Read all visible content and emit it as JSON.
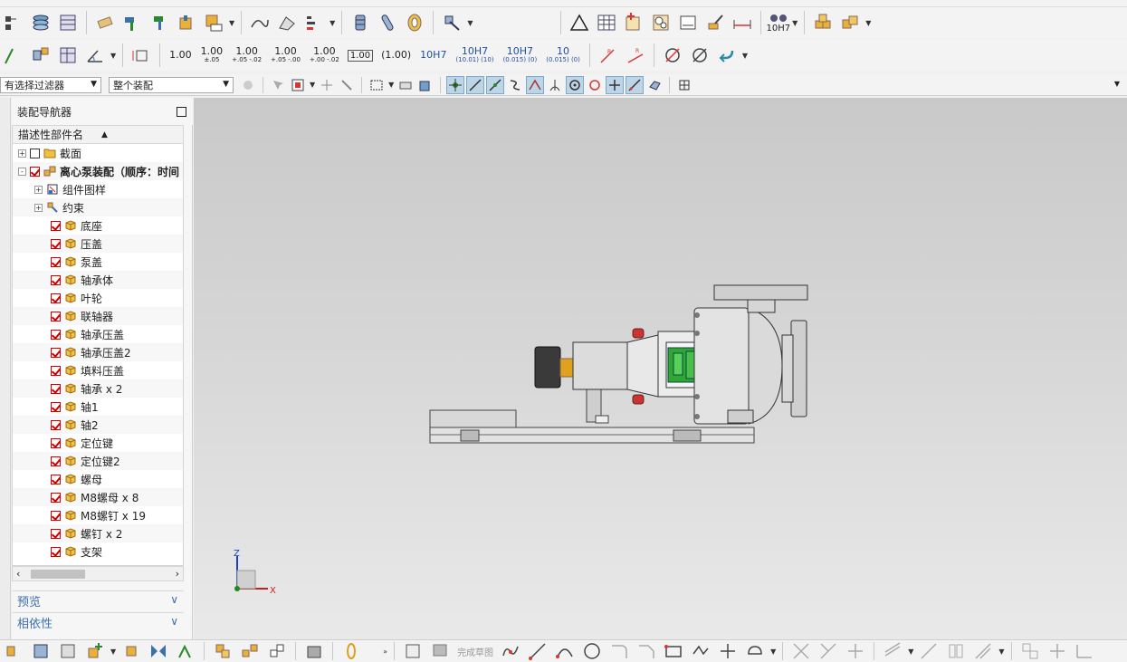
{
  "toolbar_row2": {
    "tolerances": [
      {
        "main": "1.00",
        "sub": ""
      },
      {
        "main": "1.00",
        "sub": "±.05"
      },
      {
        "main": "1.00",
        "sub": "+.05 -.02"
      },
      {
        "main": "1.00",
        "sub": "+.05 -.00"
      },
      {
        "main": "1.00",
        "sub": "+.00 -.02"
      }
    ],
    "boxed_value": "1.00",
    "paren_value": "(1.00)",
    "fit1": "10H7",
    "fit2_main": "10H7",
    "fit2_sub": "(10.01) (10)",
    "fit3_main": "10H7",
    "fit3_sub": "(0.015) (0)",
    "fit4_main": "10",
    "fit4_sub": "(0.015) (0)"
  },
  "toolbar_row1": {
    "fit_dropdown_label": "10H7"
  },
  "selection_bar": {
    "filter_value": "有选择过滤器",
    "scope_value": "整个装配"
  },
  "navigator": {
    "title": "装配导航器",
    "column_header": "描述性部件名",
    "tree": [
      {
        "label": "截面",
        "level": 0,
        "expander": "+",
        "checked": false,
        "icon": "folder"
      },
      {
        "label": "离心泵装配（顺序：时间",
        "level": 0,
        "expander": "-",
        "checked": true,
        "icon": "assembly",
        "bold": true
      },
      {
        "label": "组件图样",
        "level": 1,
        "expander": "+",
        "icon": "drawing"
      },
      {
        "label": "约束",
        "level": 1,
        "expander": "+",
        "icon": "constraint"
      },
      {
        "label": "底座",
        "level": 2,
        "checked": true,
        "icon": "part"
      },
      {
        "label": "压盖",
        "level": 2,
        "checked": true,
        "icon": "part"
      },
      {
        "label": "泵盖",
        "level": 2,
        "checked": true,
        "icon": "part"
      },
      {
        "label": "轴承体",
        "level": 2,
        "checked": true,
        "icon": "part"
      },
      {
        "label": "叶轮",
        "level": 2,
        "checked": true,
        "icon": "part"
      },
      {
        "label": "联轴器",
        "level": 2,
        "checked": true,
        "icon": "part"
      },
      {
        "label": "轴承压盖",
        "level": 2,
        "checked": true,
        "icon": "part"
      },
      {
        "label": "轴承压盖2",
        "level": 2,
        "checked": true,
        "icon": "part"
      },
      {
        "label": "填料压盖",
        "level": 2,
        "checked": true,
        "icon": "part"
      },
      {
        "label": "轴承 x 2",
        "level": 2,
        "checked": true,
        "icon": "part"
      },
      {
        "label": "轴1",
        "level": 2,
        "checked": true,
        "icon": "part"
      },
      {
        "label": "轴2",
        "level": 2,
        "checked": true,
        "icon": "part"
      },
      {
        "label": "定位键",
        "level": 2,
        "checked": true,
        "icon": "part"
      },
      {
        "label": "定位键2",
        "level": 2,
        "checked": true,
        "icon": "part"
      },
      {
        "label": "螺母",
        "level": 2,
        "checked": true,
        "icon": "part"
      },
      {
        "label": "M8螺母 x 8",
        "level": 2,
        "checked": true,
        "icon": "part"
      },
      {
        "label": "M8螺钉 x 19",
        "level": 2,
        "checked": true,
        "icon": "part"
      },
      {
        "label": "螺钉 x 2",
        "level": 2,
        "checked": true,
        "icon": "part"
      },
      {
        "label": "支架",
        "level": 2,
        "checked": true,
        "icon": "part"
      }
    ],
    "preview_label": "预览",
    "dependency_label": "相依性"
  },
  "viewport": {
    "axis_z": "Z",
    "axis_x": "X"
  },
  "bottombar": {
    "finish_sketch": "完成草图"
  },
  "colors": {
    "accent_blue": "#3a6fb0",
    "check_red": "#cc0000",
    "part_yellow": "#e8b23a",
    "active_green": "#2ea82e"
  }
}
